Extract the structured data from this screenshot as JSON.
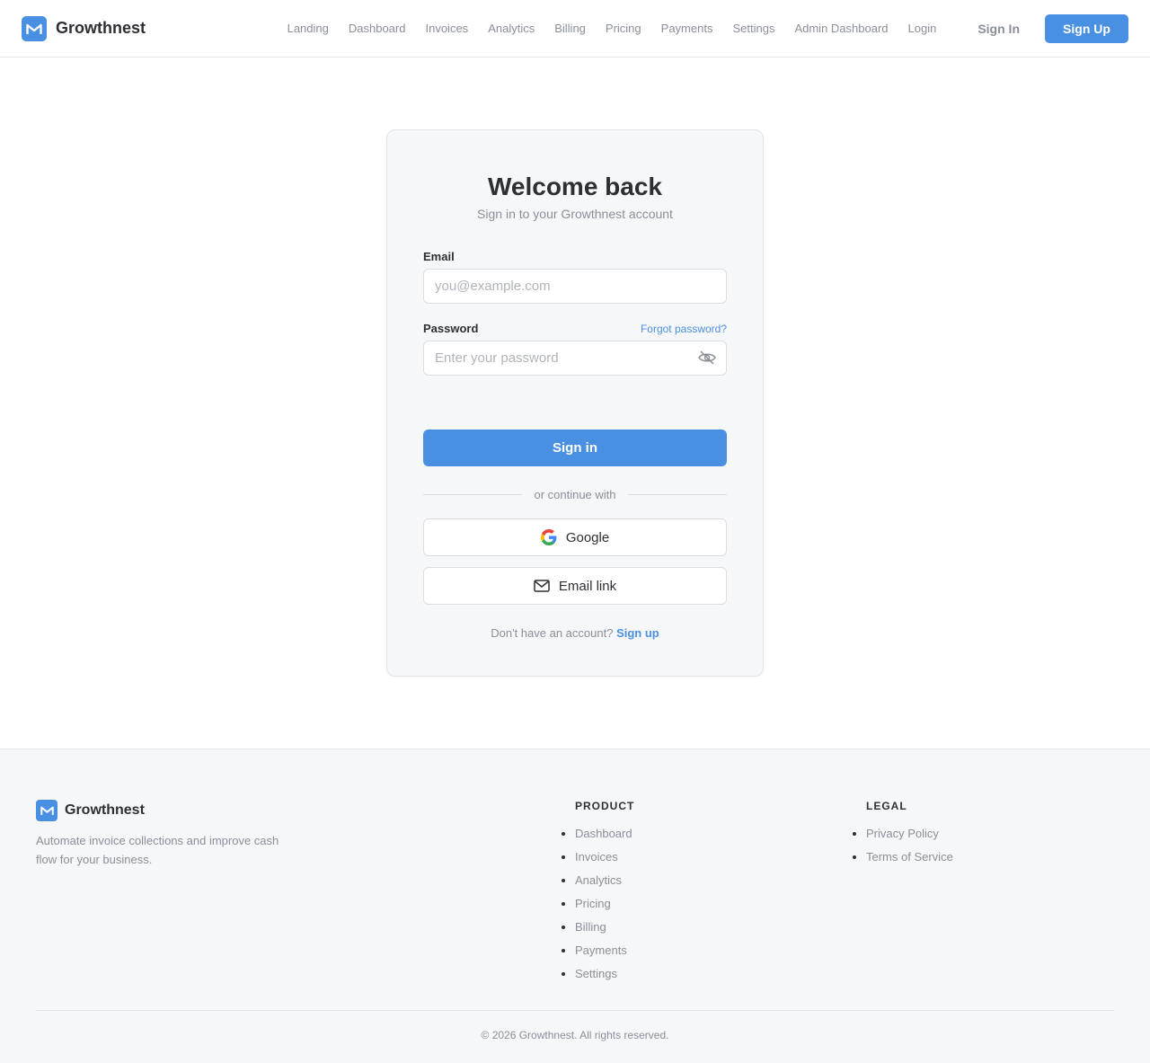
{
  "header": {
    "brand": "Growthnest",
    "nav": [
      "Landing",
      "Dashboard",
      "Invoices",
      "Analytics",
      "Billing",
      "Pricing",
      "Payments",
      "Settings",
      "Admin Dashboard",
      "Login"
    ],
    "sign_in": "Sign In",
    "sign_up": "Sign Up"
  },
  "card": {
    "title": "Welcome back",
    "subtitle": "Sign in to your Growthnest account",
    "email_label": "Email",
    "email_placeholder": "you@example.com",
    "password_label": "Password",
    "forgot": "Forgot password?",
    "password_placeholder": "Enter your password",
    "submit": "Sign in",
    "divider": "or continue with",
    "google": "Google",
    "email_link": "Email link",
    "no_account": "Don't have an account?",
    "sign_up_link": "Sign up"
  },
  "footer": {
    "brand": "Growthnest",
    "description": "Automate invoice collections and improve cash flow for your business.",
    "product_heading": "PRODUCT",
    "product_links": [
      "Dashboard",
      "Invoices",
      "Analytics",
      "Pricing",
      "Billing",
      "Payments",
      "Settings"
    ],
    "legal_heading": "LEGAL",
    "legal_links": [
      "Privacy Policy",
      "Terms of Service"
    ],
    "copyright": "© 2026 Growthnest. All rights reserved."
  },
  "colors": {
    "accent": "#4a90e2",
    "text": "#2d2f33",
    "muted": "#8a8f98"
  }
}
